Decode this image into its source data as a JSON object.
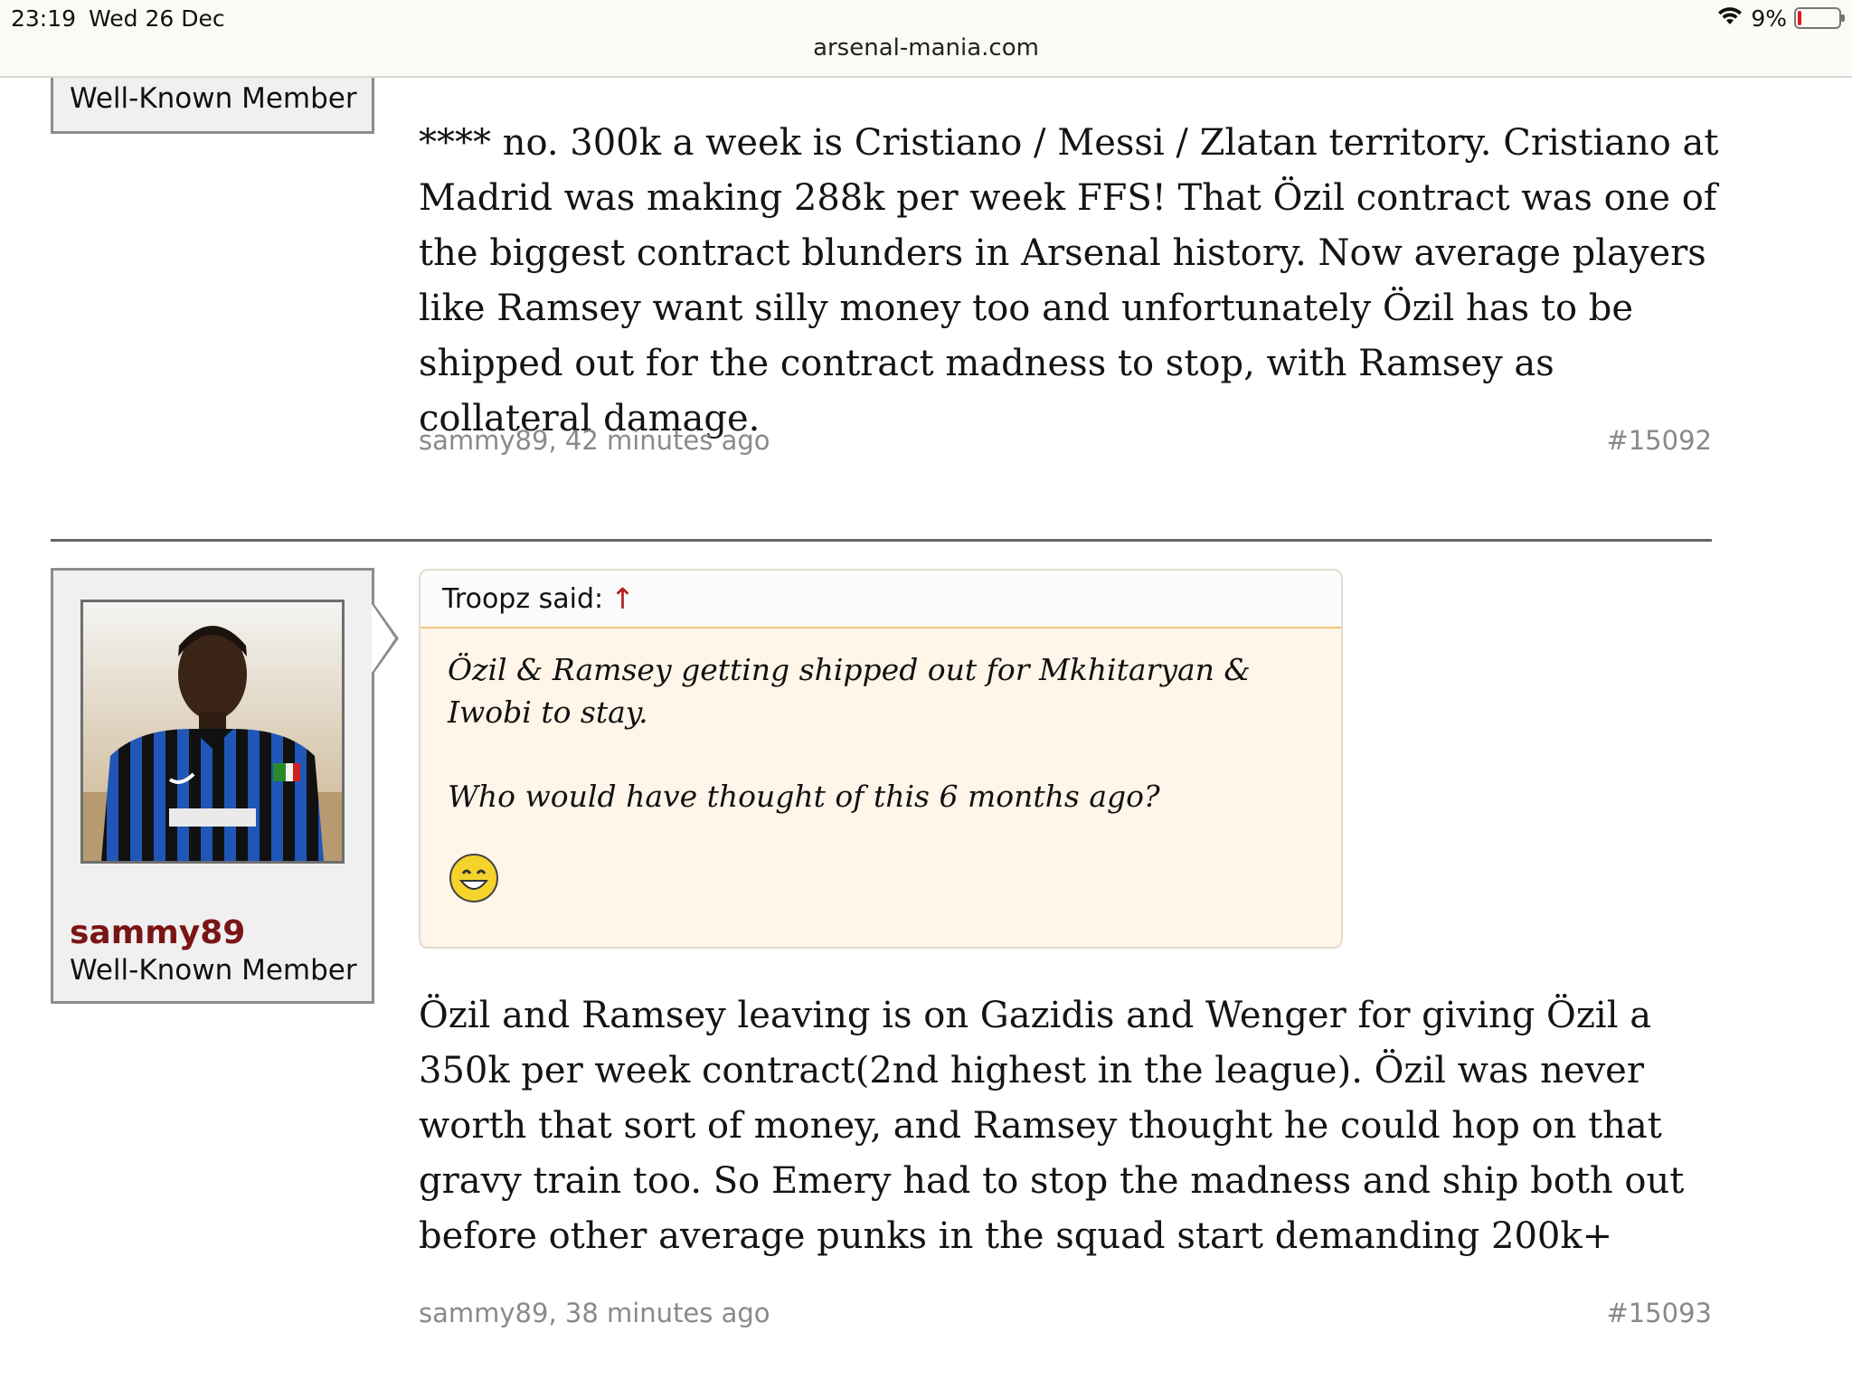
{
  "status_bar": {
    "time": "23:19",
    "date": "Wed 26 Dec",
    "battery": "9%",
    "battery_level_percent": 9
  },
  "browser": {
    "url": "arsenal-mania.com"
  },
  "posts": [
    {
      "role": "Well-Known Member",
      "body": "**** no. 300k a week is Cristiano / Messi / Zlatan territory. Cristiano at Madrid was making 288k per week FFS! That Özil contract was one of the biggest contract blunders in Arsenal history. Now average players like Ramsey want silly money too and unfortunately Özil has to be shipped out for the contract madness to stop, with Ramsey as collateral damage.",
      "meta": "sammy89, 42 minutes ago",
      "number": "#15092"
    },
    {
      "username": "sammy89",
      "role": "Well-Known Member",
      "quote": {
        "author": "Troopz said:",
        "arrow": "↑",
        "line1": "Özil & Ramsey getting shipped out for Mkhitaryan & Iwobi to stay.",
        "line2": "Who would have thought of this 6 months ago?",
        "smiley": "smile-icon"
      },
      "body": "Özil and Ramsey leaving is on Gazidis and Wenger for giving Özil a 350k per week contract(2nd highest in the league). Özil was never worth that sort of money, and Ramsey thought he could hop on that gravy train too. So Emery had to stop the madness and ship both out before other average punks in the squad start demanding 200k+",
      "meta": "sammy89, 38 minutes ago",
      "number": "#15093"
    }
  ]
}
